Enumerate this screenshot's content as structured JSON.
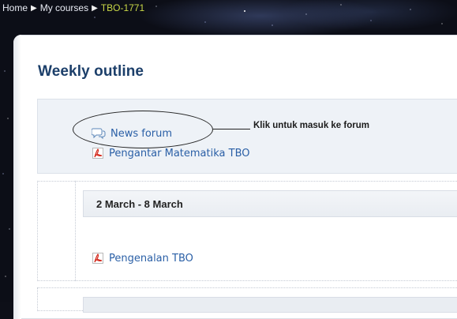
{
  "breadcrumb": {
    "items": [
      {
        "label": "Home"
      },
      {
        "label": "My courses"
      },
      {
        "label": "TBO-1771"
      }
    ],
    "separator": "▶"
  },
  "outline": {
    "title": "Weekly outline"
  },
  "section0": {
    "activities": [
      {
        "label": "News forum",
        "icon": "forum-icon"
      },
      {
        "label": "Pengantar Matematika TBO",
        "icon": "pdf-icon"
      }
    ]
  },
  "callout": {
    "text": "Klik untuk masuk ke forum"
  },
  "week1": {
    "header": "2 March - 8 March",
    "activities": [
      {
        "label": "Pengenalan TBO",
        "icon": "pdf-icon"
      }
    ]
  },
  "colors": {
    "link": "#2a5fa6",
    "title": "#1c3f6a",
    "breadcrumb_current": "#c9d847",
    "section_bg": "#eef2f7"
  }
}
